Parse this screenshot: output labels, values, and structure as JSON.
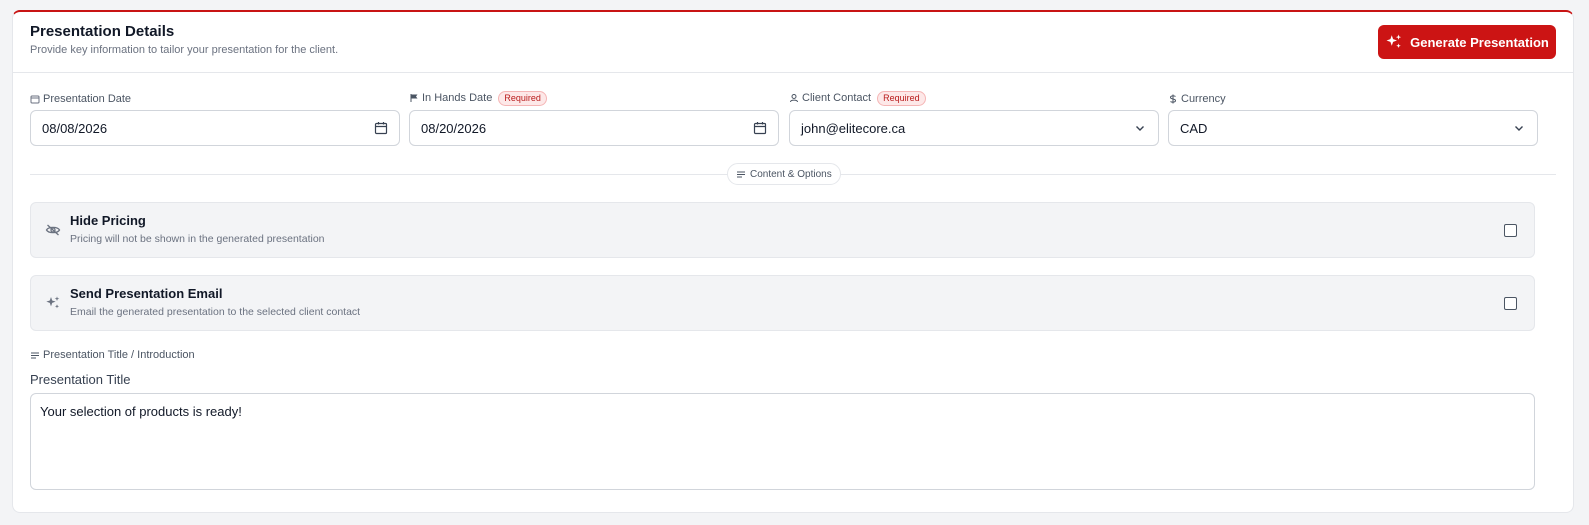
{
  "header": {
    "title": "Presentation Details",
    "subtitle": "Provide key information to tailor your presentation for the client.",
    "generate_button_label": "Generate Presentation",
    "generate_button_icon": "sparkles-icon"
  },
  "fields": {
    "presentation_date": {
      "label": "Presentation Date",
      "icon": "calendar-icon",
      "value": "08/08/2026"
    },
    "in_hands_date": {
      "label": "In Hands Date",
      "icon": "flag-icon",
      "badge": "Required",
      "value": "08/20/2026"
    },
    "client_contact": {
      "label": "Client Contact",
      "icon": "user-icon",
      "badge": "Required",
      "value": "john@elitecore.ca"
    },
    "currency": {
      "label": "Currency",
      "icon": "dollar-icon",
      "value": "CAD"
    }
  },
  "divider": {
    "label": "Content & Options"
  },
  "options": {
    "hide_pricing": {
      "title": "Hide Pricing",
      "description": "Pricing will not be shown in the generated presentation",
      "icon": "eye-off-icon",
      "checked": false
    },
    "send_email": {
      "title": "Send Presentation Email",
      "description": "Email the generated presentation to the selected client contact",
      "icon": "sparkles-icon",
      "checked": false
    }
  },
  "intro": {
    "section_label": "Presentation Title / Introduction",
    "title_label": "Presentation Title",
    "title_value": "Your selection of products is ready!"
  },
  "colors": {
    "accent": "#cc1414",
    "badge_text": "#b91c1c",
    "badge_bg": "#fde8e8"
  }
}
